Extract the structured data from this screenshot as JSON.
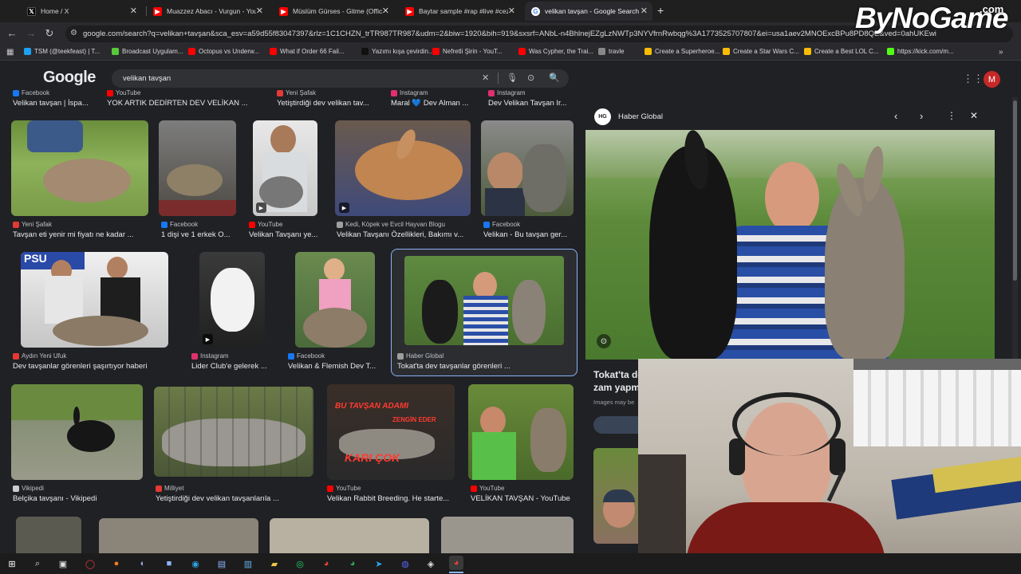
{
  "tabs": [
    {
      "label": "Home / X"
    },
    {
      "label": "Muazzez Abacı - Vurgun - YouT"
    },
    {
      "label": "Müslüm Gürses - Gitme (Offici"
    },
    {
      "label": "Baytar sample #rap #live #ceza"
    },
    {
      "label": "velikan tavşan - Google Search"
    }
  ],
  "new_tab": "+",
  "url": "google.com/search?q=velikan+tavşan&sca_esv=a59d55f83047397&rlz=1C1CHZN_trTR987TR987&udm=2&biw=1920&bih=919&sxsrf=ANbL-n4BhlnejEZgLzNWTp3NYVfrnRwbqg%3A1773525707807&ei=usa1aev2MNOExcBPu8PD8QE&ved=0ahUKEwi",
  "bookmarks": [
    {
      "label": "TSM (@teekfeast) | T...",
      "color": "#1da1f2"
    },
    {
      "label": "Broadcast Uygulam...",
      "color": "#59c93b"
    },
    {
      "label": "Octopus vs Underw...",
      "color": "#ff0000"
    },
    {
      "label": "What if Order 66 Fail...",
      "color": "#ff0000"
    },
    {
      "label": "Yazımı kışa çevirdin...",
      "color": "#111111"
    },
    {
      "label": "Nefretli Şirin - YouT...",
      "color": "#ff0000"
    },
    {
      "label": "Was Cypher, the Trai...",
      "color": "#ff0000"
    },
    {
      "label": "travle",
      "color": "#888888"
    },
    {
      "label": "Create a Superheroe...",
      "color": "#fbbc05"
    },
    {
      "label": "Create a Star Wars C...",
      "color": "#fbbc05"
    },
    {
      "label": "Create a Best LOL C...",
      "color": "#fbbc05"
    },
    {
      "label": "https://kick.com/m...",
      "color": "#53fc18"
    }
  ],
  "google": {
    "logo": "Google",
    "query": "velikan tavşan",
    "avatar": "M"
  },
  "top_row": [
    {
      "source": "Facebook",
      "caption": "Velikan tavşan | İspa..."
    },
    {
      "source": "YouTube",
      "caption": "YOK ARTIK DEDİRTEN DEV VELİKAN ..."
    },
    {
      "source": "Yeni Şafak",
      "caption": "Yetiştirdiği dev velikan tav..."
    },
    {
      "source": "Instagram",
      "caption": "Maral 💙 Dev Alman ..."
    },
    {
      "source": "Instagram",
      "caption": "Dev Velikan Tavşan Ir..."
    }
  ],
  "row1": [
    {
      "source": "Yeni Şafak",
      "caption": "Tavşan eti yenir mi fiyatı ne kadar ...",
      "srcColor": "#e53935"
    },
    {
      "source": "Facebook",
      "caption": "1 dişi ve 1 erkek O...",
      "srcColor": "#1877f2"
    },
    {
      "source": "YouTube",
      "caption": "Velikan Tavşanı ye...",
      "srcColor": "#ff0000"
    },
    {
      "source": "Kedi, Köpek ve Evcil Hayvan Blogu",
      "caption": "Velikan Tavşanı Özellikleri, Bakımı v...",
      "srcColor": "#9e9e9e"
    },
    {
      "source": "Facebook",
      "caption": "Velikan - Bu tavşan ger...",
      "srcColor": "#1877f2"
    }
  ],
  "row2": [
    {
      "source": "Aydın Yeni Ufuk",
      "caption": "Dev tavşanlar görenleri şaşırtıyor haberi",
      "srcColor": "#e53935"
    },
    {
      "source": "Instagram",
      "caption": "Lider Club'e gelerek ...",
      "srcColor": "#e1306c"
    },
    {
      "source": "Facebook",
      "caption": "Velikan & Flemish Dev T...",
      "srcColor": "#1877f2"
    },
    {
      "source": "Haber Global",
      "caption": "Tokat'ta dev tavşanlar görenleri ...",
      "srcColor": "#9e9e9e"
    }
  ],
  "row3": [
    {
      "source": "Vikipedi",
      "caption": "Belçika tavşanı - Vikipedi",
      "srcColor": "#cccccc"
    },
    {
      "source": "Milliyet",
      "caption": "Yetiştirdiği dev velikan tavşanlarıla ...",
      "srcColor": "#e53935"
    },
    {
      "source": "YouTube",
      "caption": "Velikan Rabbit Breeding. He starte...",
      "srcColor": "#ff0000"
    },
    {
      "source": "YouTube",
      "caption": "VELİKAN TAVŞAN - YouTube",
      "srcColor": "#ff0000"
    }
  ],
  "thumb_text": {
    "line1": "BU TAVŞAN ADAMI",
    "line2": "ZENGİN EDER",
    "line3": "KARI ÇOK"
  },
  "panel": {
    "source": "Haber Global",
    "source_initials": "HG",
    "title_line1": "Tokat'ta de",
    "title_line2": "zam yapm",
    "note": "Images may be"
  },
  "watermark": {
    "main": "ByNoGame",
    "suffix": ".com"
  },
  "colors": {
    "background": "#202124",
    "accent": "#8ab4f8",
    "selected_border": "#8ab4f8"
  }
}
